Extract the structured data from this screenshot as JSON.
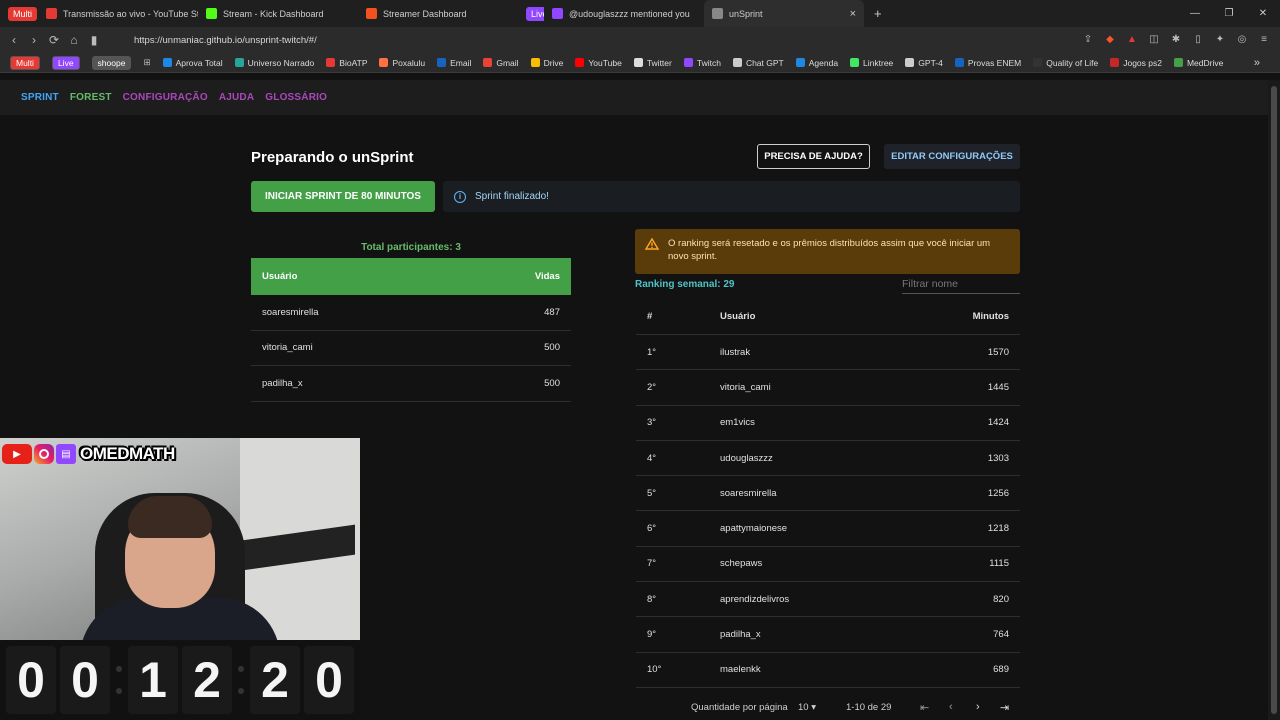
{
  "browser": {
    "tabs": [
      {
        "tag": "Multi",
        "label": "",
        "color": "#e53935"
      },
      {
        "label": "Transmissão ao vivo - YouTube Studio",
        "color": "#e53935"
      },
      {
        "label": "Stream - Kick Dashboard",
        "color": "#53fc18"
      },
      {
        "label": "Streamer Dashboard",
        "color": "#f4511e"
      },
      {
        "tag": "Live",
        "label": "",
        "color": "#9146ff"
      },
      {
        "label": "@udouglaszzz mentioned you",
        "color": "#9146ff"
      },
      {
        "label": "unSprint",
        "color": "#888888",
        "active": true
      }
    ],
    "url": "https://unmaniac.github.io/unsprint-twitch/#/",
    "bookmarks": [
      {
        "label": "Multi",
        "pill": true,
        "color": "#e53935"
      },
      {
        "label": "Live",
        "pill": true,
        "color": "#9146ff"
      },
      {
        "label": "shoope",
        "pill": true,
        "color": "#555555"
      },
      {
        "label": "Aprova Total",
        "color": "#1e88e5"
      },
      {
        "label": "Universo Narrado",
        "color": "#26a69a"
      },
      {
        "label": "BioATP",
        "color": "#e53935"
      },
      {
        "label": "Poxalulu",
        "color": "#ff7043"
      },
      {
        "label": "Email",
        "color": "#1565c0"
      },
      {
        "label": "Gmail",
        "color": "#ea4335"
      },
      {
        "label": "Drive",
        "color": "#fbbc04"
      },
      {
        "label": "YouTube",
        "color": "#ff0000"
      },
      {
        "label": "Twitter",
        "color": "#dddddd"
      },
      {
        "label": "Twitch",
        "color": "#9146ff"
      },
      {
        "label": "Chat GPT",
        "color": "#cccccc"
      },
      {
        "label": "Agenda",
        "color": "#1e88e5"
      },
      {
        "label": "Linktree",
        "color": "#43e660"
      },
      {
        "label": "GPT-4",
        "color": "#cccccc"
      },
      {
        "label": "Provas ENEM",
        "color": "#1565c0"
      },
      {
        "label": "Quality of Life",
        "color": "#333333"
      },
      {
        "label": "Jogos ps2",
        "color": "#c62828"
      },
      {
        "label": "MedDrive",
        "color": "#43a047"
      }
    ]
  },
  "appnav": [
    {
      "label": "SPRINT",
      "color": "#42a5f5"
    },
    {
      "label": "FOREST",
      "color": "#66bb6a"
    },
    {
      "label": "CONFIGURAÇÃO",
      "color": "#ab47bc"
    },
    {
      "label": "AJUDA",
      "color": "#ab47bc"
    },
    {
      "label": "GLOSSÁRIO",
      "color": "#ab47bc"
    }
  ],
  "main": {
    "title": "Preparando o unSprint",
    "help_button": "PRECISA DE AJUDA?",
    "edit_button": "EDITAR CONFIGURAÇÕES",
    "start_button": "INICIAR SPRINT DE 80 MINUTOS",
    "info_message": "Sprint finalizado!",
    "total_participants": "Total participantes: 3",
    "participants_headers": {
      "user": "Usuário",
      "lives": "Vidas"
    },
    "participants": [
      {
        "user": "soaresmirella",
        "lives": "487"
      },
      {
        "user": "vitoria_cami",
        "lives": "500"
      },
      {
        "user": "padilha_x",
        "lives": "500"
      }
    ],
    "warning": "O ranking será resetado e os prêmios distribuídos assim que você iniciar um novo sprint.",
    "ranking_title": "Ranking semanal: 29",
    "filter_placeholder": "Filtrar nome",
    "ranking_headers": {
      "pos": "#",
      "user": "Usuário",
      "minutes": "Minutos"
    },
    "ranking": [
      {
        "pos": "1°",
        "user": "ilustrak",
        "minutes": "1570"
      },
      {
        "pos": "2°",
        "user": "vitoria_cami",
        "minutes": "1445"
      },
      {
        "pos": "3°",
        "user": "em1vics",
        "minutes": "1424"
      },
      {
        "pos": "4°",
        "user": "udouglaszzz",
        "minutes": "1303"
      },
      {
        "pos": "5°",
        "user": "soaresmirella",
        "minutes": "1256"
      },
      {
        "pos": "6°",
        "user": "apattymaionese",
        "minutes": "1218"
      },
      {
        "pos": "7°",
        "user": "schepaws",
        "minutes": "1115"
      },
      {
        "pos": "8°",
        "user": "aprendizdelivros",
        "minutes": "820"
      },
      {
        "pos": "9°",
        "user": "padilha_x",
        "minutes": "764"
      },
      {
        "pos": "10°",
        "user": "maelenkk",
        "minutes": "689"
      }
    ],
    "pager": {
      "rows_label": "Quantidade por página",
      "rows_value": "10",
      "range": "1-10 de 29"
    }
  },
  "overlay": {
    "channel_name": "OMEDMATH",
    "timer_digits": [
      "0",
      "0",
      "1",
      "2",
      "2",
      "0"
    ]
  }
}
